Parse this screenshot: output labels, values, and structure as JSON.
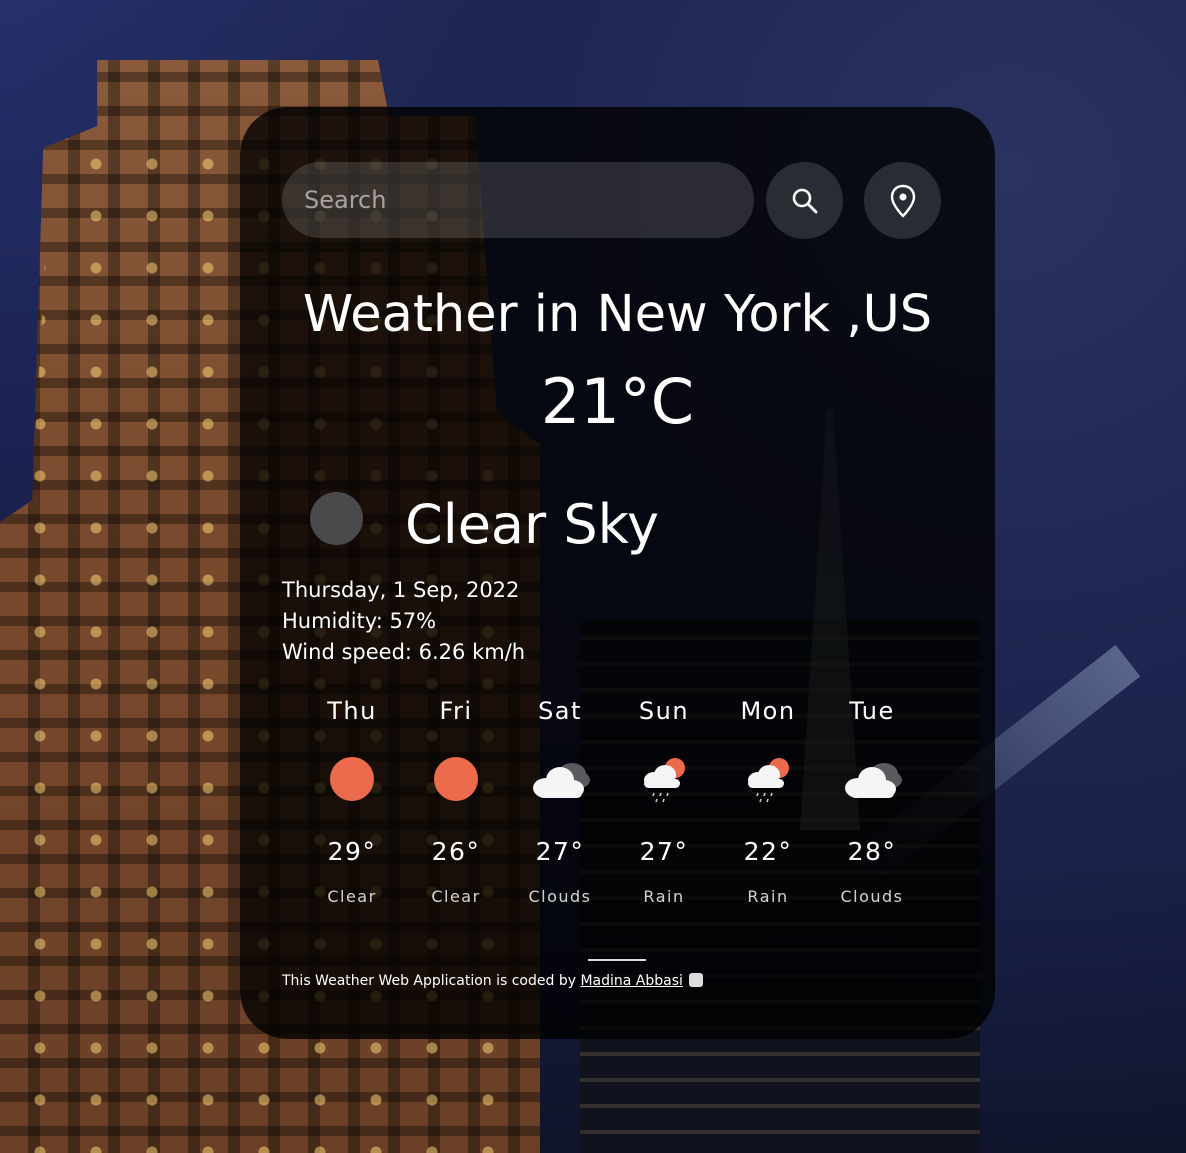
{
  "search": {
    "placeholder": "Search"
  },
  "weather": {
    "city_title": "Weather in New York ,US",
    "temperature": "21°C",
    "condition": "Clear Sky",
    "date": "Thursday, 1 Sep, 2022",
    "humidity": "Humidity: 57%",
    "wind": "Wind speed: 6.26 km/h"
  },
  "forecast": [
    {
      "day": "Thu",
      "temp": "29°",
      "desc": "Clear",
      "icon": "sun-icon"
    },
    {
      "day": "Fri",
      "temp": "26°",
      "desc": "Clear",
      "icon": "sun-icon"
    },
    {
      "day": "Sat",
      "temp": "27°",
      "desc": "Clouds",
      "icon": "clouds-icon"
    },
    {
      "day": "Sun",
      "temp": "27°",
      "desc": "Rain",
      "icon": "rain-icon"
    },
    {
      "day": "Mon",
      "temp": "22°",
      "desc": "Rain",
      "icon": "rain-icon"
    },
    {
      "day": "Tue",
      "temp": "28°",
      "desc": "Clouds",
      "icon": "clouds-icon"
    }
  ],
  "footer": {
    "text": "This Weather Web Application is coded by ",
    "author": "Madina Abbasi"
  },
  "colors": {
    "sun": "#ec6b4d",
    "card_bg": "rgba(0,0,0,0.78)",
    "cloud": "#f5f5f5",
    "cloud_dark": "#5a5a5f"
  }
}
